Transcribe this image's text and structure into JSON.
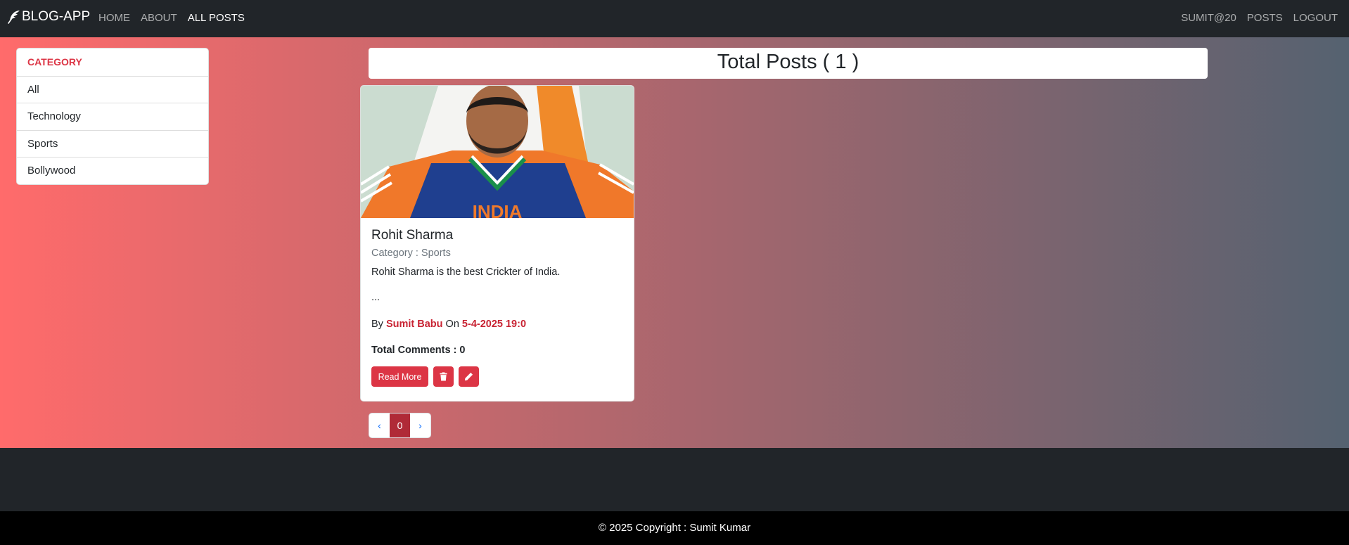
{
  "navbar": {
    "brand": "BLOG-APP",
    "left_links": [
      {
        "label": "HOME"
      },
      {
        "label": "ABOUT"
      },
      {
        "label": "ALL POSTS"
      }
    ],
    "right_links": [
      {
        "label": "SUMIT@20"
      },
      {
        "label": "POSTS"
      },
      {
        "label": "LOGOUT"
      }
    ]
  },
  "sidebar": {
    "header": "CATEGORY",
    "items": [
      {
        "label": "All"
      },
      {
        "label": "Technology"
      },
      {
        "label": "Sports"
      },
      {
        "label": "Bollywood"
      }
    ]
  },
  "main": {
    "title": "Total Posts ( 1 )",
    "posts": [
      {
        "title": "Rohit Sharma",
        "category": "Category : Sports",
        "text": "Rohit Sharma is the best Crickter of India.",
        "ellipsis": "...",
        "by_label": "By",
        "author": "Sumit Babu",
        "on_label": "On",
        "date": "5-4-2025 19:0",
        "comments": "Total Comments : 0",
        "read_more_label": "Read More"
      }
    ]
  },
  "pagination": {
    "prev": "‹",
    "current": "0",
    "next": "›"
  },
  "footer": {
    "text": "© 2025 Copyright : Sumit Kumar"
  },
  "colors": {
    "accent": "#dc3545",
    "gradient_start": "#ff6b6b",
    "gradient_end": "#556270",
    "navbar": "#212529"
  }
}
